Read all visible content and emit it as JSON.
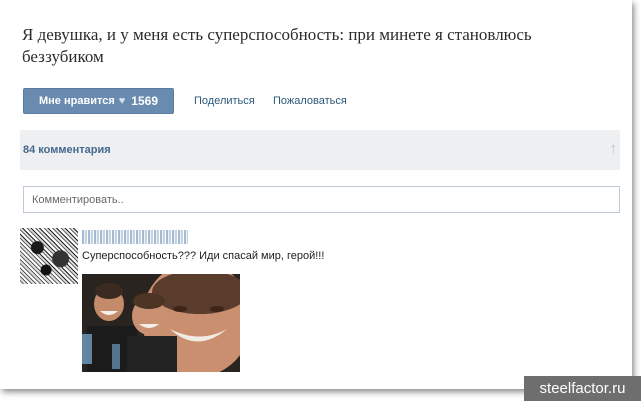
{
  "post": {
    "title": "Я девушка, и у меня есть суперспособность: при минете я становлюсь беззубиком"
  },
  "actions": {
    "like_label": "Мне нравится",
    "like_icon": "heart-icon",
    "like_count": "1569",
    "share_label": "Поделиться",
    "report_label": "Пожаловаться"
  },
  "comments": {
    "count_label": "84 комментария",
    "scroll_icon": "arrow-up-icon",
    "input_placeholder": "Комментировать.."
  },
  "comment": {
    "text": "Суперспособность??? Иди спасай мир, герой!!!"
  },
  "watermark": {
    "text": "steelfactor.ru"
  },
  "colors": {
    "like_button_bg": "#6a8bb0",
    "link": "#2b587a",
    "comments_bar_bg": "#edeff1",
    "watermark_bg": "#6e6e6e"
  }
}
